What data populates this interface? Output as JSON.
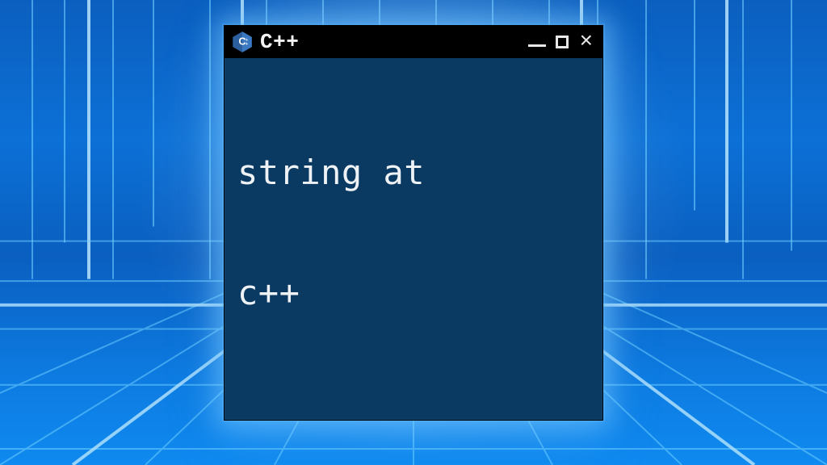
{
  "window": {
    "title": "C++",
    "content_lines": [
      "string at",
      "c++"
    ]
  },
  "icons": {
    "logo": "cpp-logo-icon",
    "minimize": "minimize-icon",
    "maximize": "maximize-icon",
    "close": "close-icon"
  },
  "colors": {
    "window_bg": "#0a3962",
    "titlebar_bg": "#000000",
    "text": "#eef2f5",
    "backdrop_accent": "#1fa3ff"
  }
}
